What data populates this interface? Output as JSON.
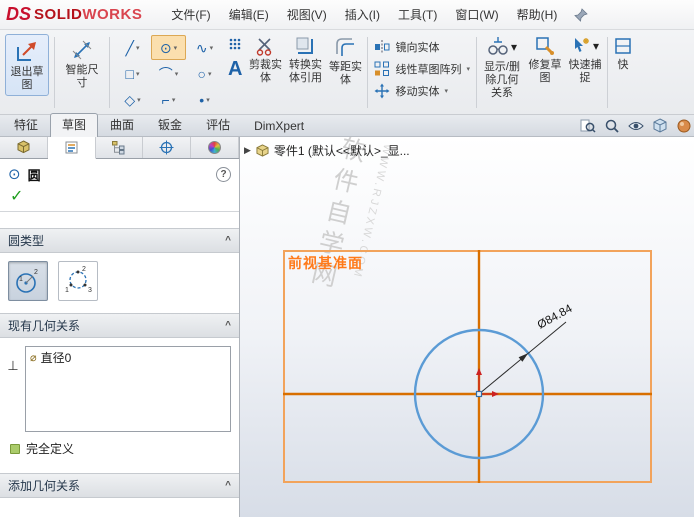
{
  "app": {
    "logo_ds": "DS",
    "logo_solid": "SOLID",
    "logo_works": "WORKS"
  },
  "menubar": {
    "items": [
      {
        "label": "文件(F)"
      },
      {
        "label": "编辑(E)"
      },
      {
        "label": "视图(V)"
      },
      {
        "label": "插入(I)"
      },
      {
        "label": "工具(T)"
      },
      {
        "label": "窗口(W)"
      },
      {
        "label": "帮助(H)"
      }
    ]
  },
  "icons": {
    "dropdown": "▾",
    "chevron_up": "^",
    "tree_expand": "▶",
    "help": "?",
    "confirm_check": "✓",
    "relation_symbol": "⊥",
    "diameter_symbol": "⌀",
    "num1": "1",
    "num2": "2",
    "num3": "3"
  },
  "ribbon": {
    "exit_sketch": {
      "label": "退出草图"
    },
    "smart_dimension": {
      "label": "智能尺寸"
    },
    "sketch_tools": [
      {
        "name": "line",
        "glyph": "╱"
      },
      {
        "name": "circle",
        "glyph": "⊙",
        "active": true
      },
      {
        "name": "spline",
        "glyph": "∿"
      },
      {
        "name": "corner-rectangle",
        "glyph": "□"
      },
      {
        "name": "centerpoint-arc",
        "glyph": "⌒"
      },
      {
        "name": "ellipse",
        "glyph": "○"
      },
      {
        "name": "polygon",
        "glyph": "◇"
      },
      {
        "name": "sketch-fillet",
        "glyph": "⌐"
      },
      {
        "name": "point",
        "glyph": "•"
      }
    ],
    "text_tool": {
      "label": "A"
    },
    "trim": {
      "label": "剪裁实体"
    },
    "convert": {
      "label": "转换实体引用"
    },
    "offset": {
      "label": "等距实体"
    },
    "mirror": {
      "label": "镜向实体"
    },
    "linear_pattern": {
      "label": "线性草图阵列"
    },
    "move": {
      "label": "移动实体"
    },
    "display_relations": {
      "label": "显示/删除几何关系"
    },
    "repair": {
      "label": "修复草图"
    },
    "quick_snaps": {
      "label": "快速捕捉"
    },
    "clipped_tool": {
      "label": "快"
    }
  },
  "tabbar": {
    "tabs": [
      {
        "label": "特征",
        "active": false
      },
      {
        "label": "草图",
        "active": true
      },
      {
        "label": "曲面",
        "active": false
      },
      {
        "label": "钣金",
        "active": false
      },
      {
        "label": "评估",
        "active": false
      },
      {
        "label": "DimXpert",
        "active": false
      }
    ]
  },
  "panel": {
    "title": "圆",
    "sections": {
      "circle_type": "圆类型",
      "existing_relations": "现有几何关系",
      "add_relations": "添加几何关系"
    },
    "relations": [
      {
        "label": "直径0"
      }
    ],
    "status": "完全定义"
  },
  "canvas": {
    "tree_item": "零件1 (默认<<默认>_显...",
    "plane_label": "前视基准面",
    "watermark_cjk": "软件自学网",
    "watermark_latin": "WWW.RJZXW.COM",
    "dimension_label": "Ø84.84"
  },
  "colors": {
    "logo_red": "#c8102e",
    "plane_border": "#f2a35b",
    "plane_label_orange": "#ff7a1a",
    "centerline_orange": "#d86f00",
    "circle_blue": "#5b9bd5",
    "origin_red": "#cc2222",
    "check_green": "#1e9e1e",
    "tool_highlight": "#fbdfae"
  }
}
